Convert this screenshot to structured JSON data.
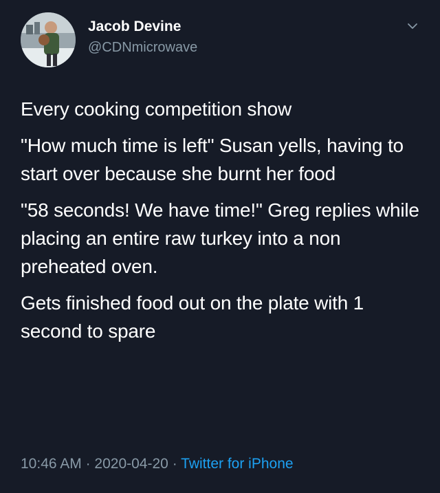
{
  "author": {
    "display_name": "Jacob Devine",
    "handle": "@CDNmicrowave",
    "avatar_icon": "profile-photo"
  },
  "header": {
    "menu_icon": "chevron-down-icon"
  },
  "tweet": {
    "paragraphs": [
      "Every cooking competition show",
      "\"How much time is left\" Susan yells, having to start over because she burnt her food",
      "\"58 seconds! We have time!\" Greg replies while placing an entire raw turkey into a non preheated oven.",
      "Gets finished food out on the plate with 1 second to spare"
    ]
  },
  "meta": {
    "time": "10:46 AM",
    "separator": "·",
    "date": "2020-04-20",
    "source": "Twitter for iPhone"
  },
  "colors": {
    "background": "#161b27",
    "text": "#ffffff",
    "secondary": "#8899a6",
    "link": "#1da1f2"
  }
}
